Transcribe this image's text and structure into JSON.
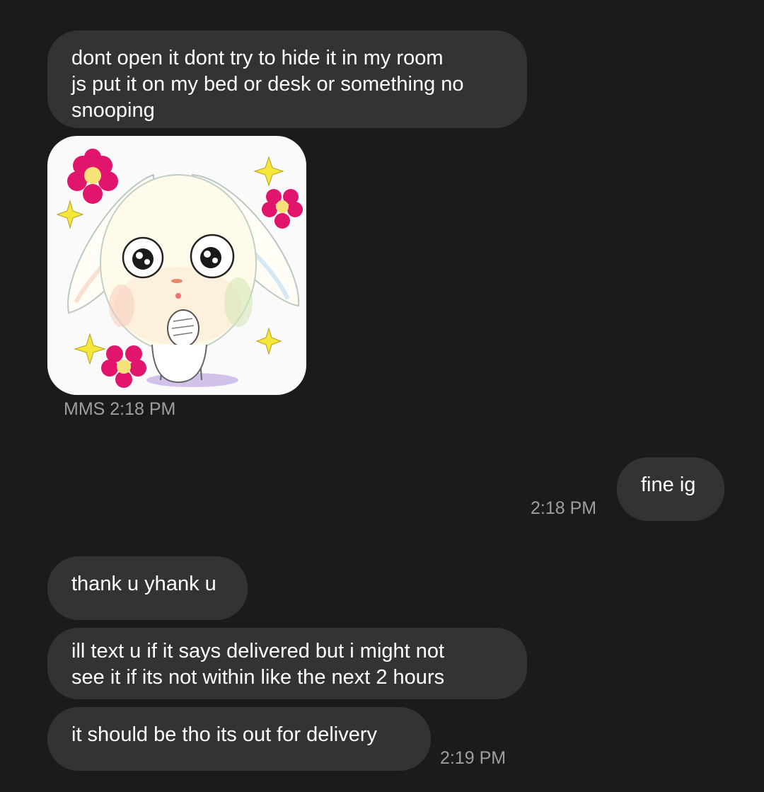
{
  "conversation": {
    "messages": [
      {
        "direction": "incoming",
        "lines": [
          "dont open it dont try to hide it in my room",
          "js put it on my bed or desk or something no",
          "snooping"
        ]
      },
      {
        "direction": "incoming",
        "type": "sticker",
        "sticker_description": "white fluffy bunny with big eyes, hands clasped, pink flowers and yellow sparkles",
        "meta": "MMS 2:18 PM"
      },
      {
        "direction": "outgoing",
        "lines": [
          "fine ig"
        ],
        "time": "2:18 PM"
      },
      {
        "direction": "incoming",
        "lines": [
          "thank u yhank u"
        ]
      },
      {
        "direction": "incoming",
        "lines": [
          "ill text u if it says delivered but i might not",
          "see it if its not within like the next 2 hours"
        ]
      },
      {
        "direction": "incoming",
        "lines": [
          "it should be tho its out for delivery"
        ],
        "time": "2:19 PM"
      }
    ]
  },
  "colors": {
    "background": "#1b1b1b",
    "bubble": "#333333",
    "text": "#ffffff",
    "timestamp": "#9e9e9e",
    "flower": "#e0156b",
    "sparkle": "#f5e63a"
  }
}
